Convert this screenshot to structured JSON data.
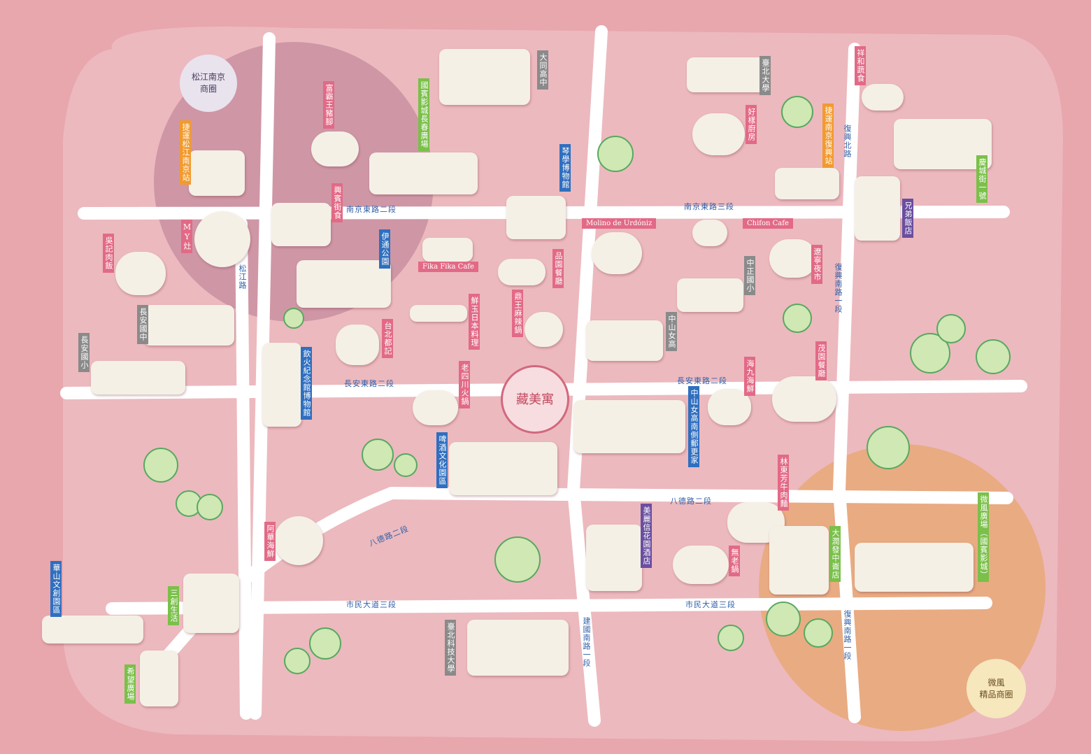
{
  "colors": {
    "bg": "#e8a6ad",
    "road": "#ffffff",
    "food": "#e26a86",
    "culture": "#2f6fbf",
    "transit": "#f29a2e",
    "park": "#7ac04a",
    "place": "#8a8a8a",
    "hotel": "#6a4ea0",
    "road_text": "#2f5fa8"
  },
  "districts": {
    "songjiang": "松江南京\n商圈",
    "xinyi": "微風\n精品商圈"
  },
  "center": {
    "name": "藏美寓"
  },
  "roads": {
    "nanjing2": "南京東路二段",
    "nanjing3": "南京東路三段",
    "changan2": "長安東路二段",
    "changan2b": "長安東路二段",
    "bade2a": "八德路二段",
    "bade2b": "八德路二段",
    "shimin3a": "市民大道三段",
    "shimin3b": "市民大道三段",
    "songjiang": "松江路",
    "fuxing_n": "復興北路",
    "fuxing_s1": "復興南路一段",
    "fuxing_s1b": "復興南路一段",
    "jianguo": "建國南路一段"
  },
  "english": {
    "molino": "Molino de Urdóniz",
    "chifon": "Chifon Cafe",
    "fika": "Fika Fika Cafe"
  },
  "labels": [
    {
      "id": "yuanyi",
      "text": "富霸王豬腳",
      "type": "food"
    },
    {
      "id": "guobin",
      "text": "國賓影城長春廣場",
      "type": "park"
    },
    {
      "id": "datong",
      "text": "大同高中",
      "type": "place"
    },
    {
      "id": "taibei_u",
      "text": "臺北大學",
      "type": "place"
    },
    {
      "id": "haoyang",
      "text": "好樣廚房",
      "type": "food"
    },
    {
      "id": "xianghe",
      "text": "祥和蔬食",
      "type": "food"
    },
    {
      "id": "mrt_fuxing",
      "text": "捷運南京復興站",
      "type": "transit"
    },
    {
      "id": "qingcheng",
      "text": "慶城街一號",
      "type": "park"
    },
    {
      "id": "brother",
      "text": "兄弟飯店",
      "type": "hotel"
    },
    {
      "id": "mrt_songjiang",
      "text": "捷運松江南京站",
      "type": "transit"
    },
    {
      "id": "xingbin",
      "text": "興賓街食",
      "type": "food"
    },
    {
      "id": "qinmei",
      "text": "琴學博物館",
      "type": "culture"
    },
    {
      "id": "my",
      "text": "MY灶",
      "type": "food"
    },
    {
      "id": "gaoji",
      "text": "吳記肉飯",
      "type": "food"
    },
    {
      "id": "yitong",
      "text": "伊通公園",
      "type": "culture"
    },
    {
      "id": "pinyuan",
      "text": "品園餐廳",
      "type": "food"
    },
    {
      "id": "zhongzheng",
      "text": "中正國小",
      "type": "place"
    },
    {
      "id": "liaoning",
      "text": "遼寧夜市",
      "type": "food"
    },
    {
      "id": "changan_jh",
      "text": "長安國中",
      "type": "place"
    },
    {
      "id": "changan_es",
      "text": "長安國小",
      "type": "place"
    },
    {
      "id": "xianyu",
      "text": "鮮玉日本料理",
      "type": "food"
    },
    {
      "id": "dingwang",
      "text": "鼎王麻辣鍋",
      "type": "food"
    },
    {
      "id": "zhongshan_gh",
      "text": "中山女高",
      "type": "place"
    },
    {
      "id": "taibei_duji",
      "text": "台北都記",
      "type": "food"
    },
    {
      "id": "laosichuan",
      "text": "老四川火鍋",
      "type": "food"
    },
    {
      "id": "maoyuan",
      "text": "茂園餐廳",
      "type": "food"
    },
    {
      "id": "haijiu",
      "text": "海九海鮮",
      "type": "food"
    },
    {
      "id": "fire_museum",
      "text": "飲火紀念館博物館",
      "type": "culture"
    },
    {
      "id": "zhongshan_old",
      "text": "中山女高南側郵更家",
      "type": "culture"
    },
    {
      "id": "huashan1914",
      "text": "啤酒文化園區",
      "type": "culture"
    },
    {
      "id": "linshen",
      "text": "林東芳牛肉麵",
      "type": "food"
    },
    {
      "id": "ahua",
      "text": "阿華海鮮",
      "type": "food"
    },
    {
      "id": "mela",
      "text": "美麗信花園酒店",
      "type": "hotel"
    },
    {
      "id": "laoshi",
      "text": "無老鍋",
      "type": "food"
    },
    {
      "id": "bigdome",
      "text": "大潤發中崙店",
      "type": "park"
    },
    {
      "id": "breeze",
      "text": "微風廣場（國賓影城）",
      "type": "park"
    },
    {
      "id": "huashan",
      "text": "華山文創園區",
      "type": "culture"
    },
    {
      "id": "sanchuang",
      "text": "三創生活",
      "type": "park"
    },
    {
      "id": "ntut",
      "text": "臺北科技大學",
      "type": "place"
    },
    {
      "id": "xiwang",
      "text": "希望廣場",
      "type": "park"
    }
  ]
}
